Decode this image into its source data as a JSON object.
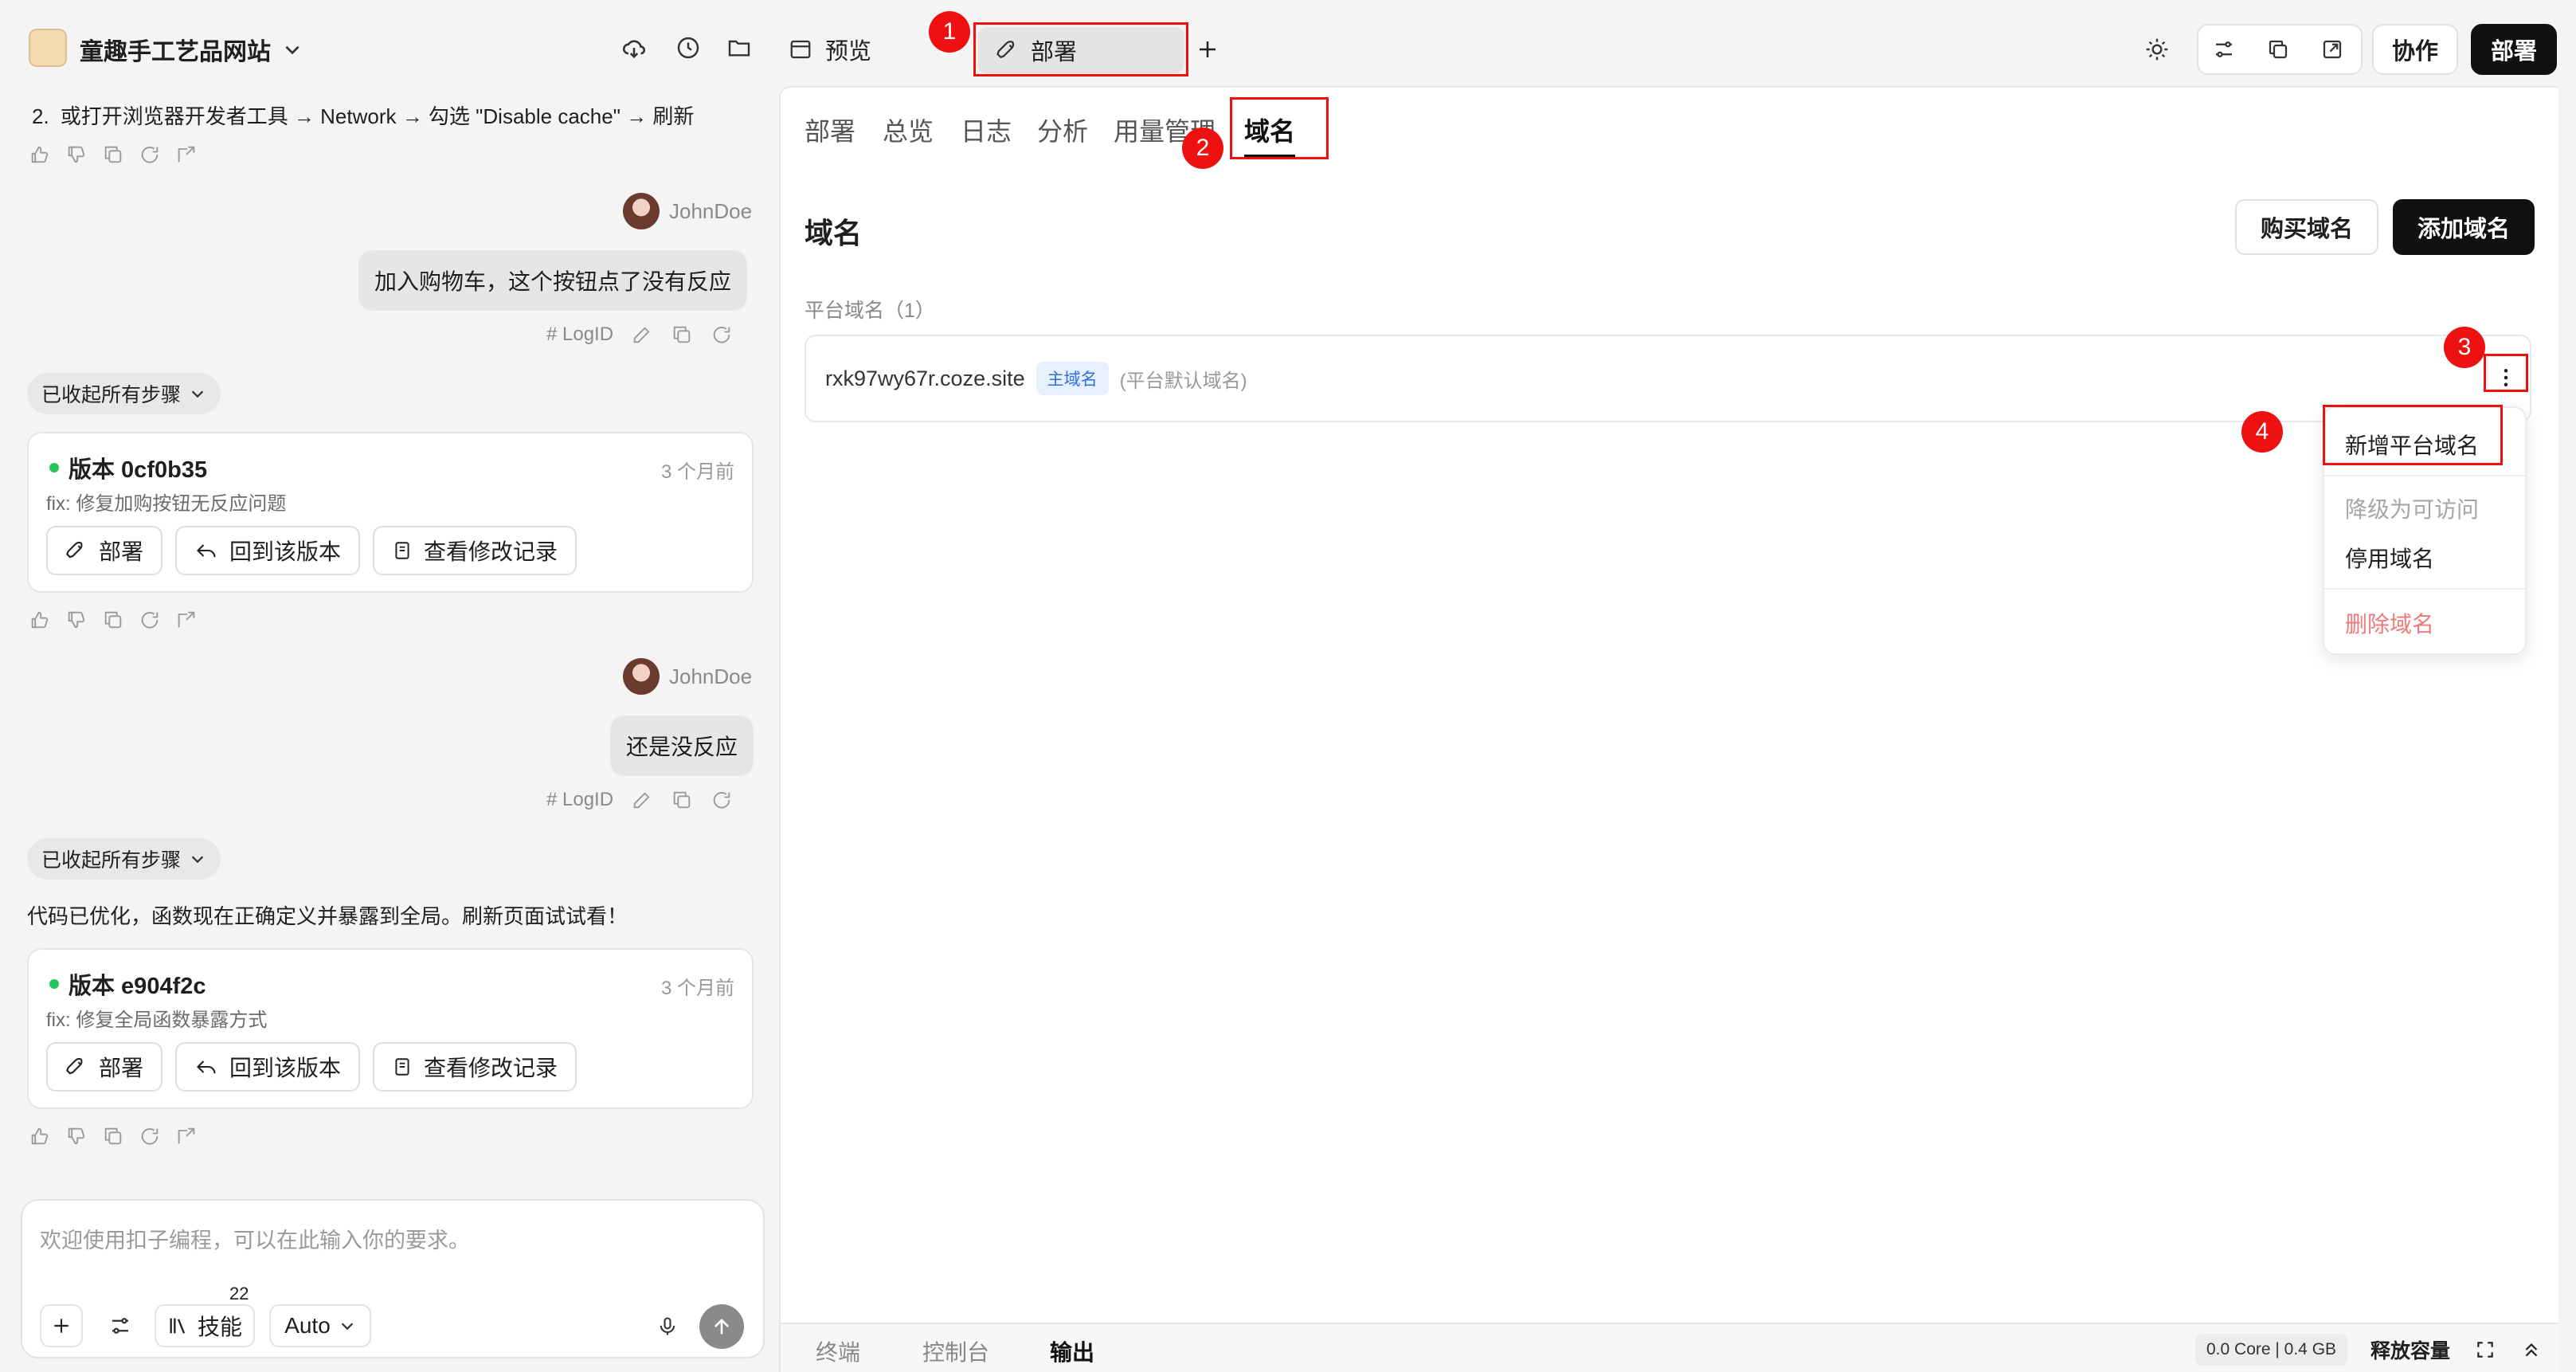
{
  "header": {
    "project_name": "童趣手工艺品网站",
    "tabs": [
      {
        "label": "预览",
        "icon": "browser-window-icon"
      },
      {
        "label": "部署",
        "icon": "rocket-icon",
        "active": true
      }
    ],
    "collaborate_label": "协作",
    "deploy_label": "部署"
  },
  "chat": {
    "step_line_number": "2.",
    "step_line": "或打开浏览器开发者工具 → Network → 勾选 \"Disable cache\" → 刷新",
    "messages": [
      {
        "user": "JohnDoe",
        "text": "加入购物车，这个按钮点了没有反应",
        "logid": "LogID"
      },
      {
        "user": "JohnDoe",
        "text": "还是没反应",
        "logid": "LogID"
      }
    ],
    "collapse_label": "已收起所有步骤",
    "assistant_reply": "代码已优化，函数现在正确定义并暴露到全局。刷新页面试试看！",
    "versions": [
      {
        "title": "版本 0cf0b35",
        "time": "3 个月前",
        "desc": "fix: 修复加购按钮无反应问题"
      },
      {
        "title": "版本 e904f2c",
        "time": "3 个月前",
        "desc": "fix: 修复全局函数暴露方式"
      }
    ],
    "version_actions": {
      "deploy": "部署",
      "revert": "回到该版本",
      "history": "查看修改记录"
    }
  },
  "composer": {
    "placeholder": "欢迎使用扣子编程，可以在此输入你的要求。",
    "skills_label": "技能",
    "skills_count": "22",
    "mode_label": "Auto"
  },
  "deploy_panel": {
    "subtabs": [
      "部署",
      "总览",
      "日志",
      "分析",
      "用量管理",
      "域名"
    ],
    "active_subtab": "域名",
    "section_title": "域名",
    "buy_domain": "购买域名",
    "add_domain": "添加域名",
    "platform_domain_label": "平台域名（1）",
    "domain": {
      "host": "rxk97wy67r.coze.site",
      "badge": "主域名",
      "note": "(平台默认域名)"
    },
    "menu": [
      "新增平台域名",
      "降级为可访问",
      "停用域名",
      "删除域名"
    ]
  },
  "annotations": [
    "1",
    "2",
    "3",
    "4"
  ],
  "bottom": {
    "tabs": [
      "终端",
      "控制台",
      "输出"
    ],
    "active_tab": "输出",
    "resource": "0.0 Core | 0.4 GB",
    "release_label": "释放容量"
  },
  "colors": {
    "accent_dark": "#111111",
    "annotation_red": "#ee1111",
    "badge_blue": "#2f6fe0",
    "success_green": "#22c55e",
    "danger_red": "#f07a7a"
  }
}
